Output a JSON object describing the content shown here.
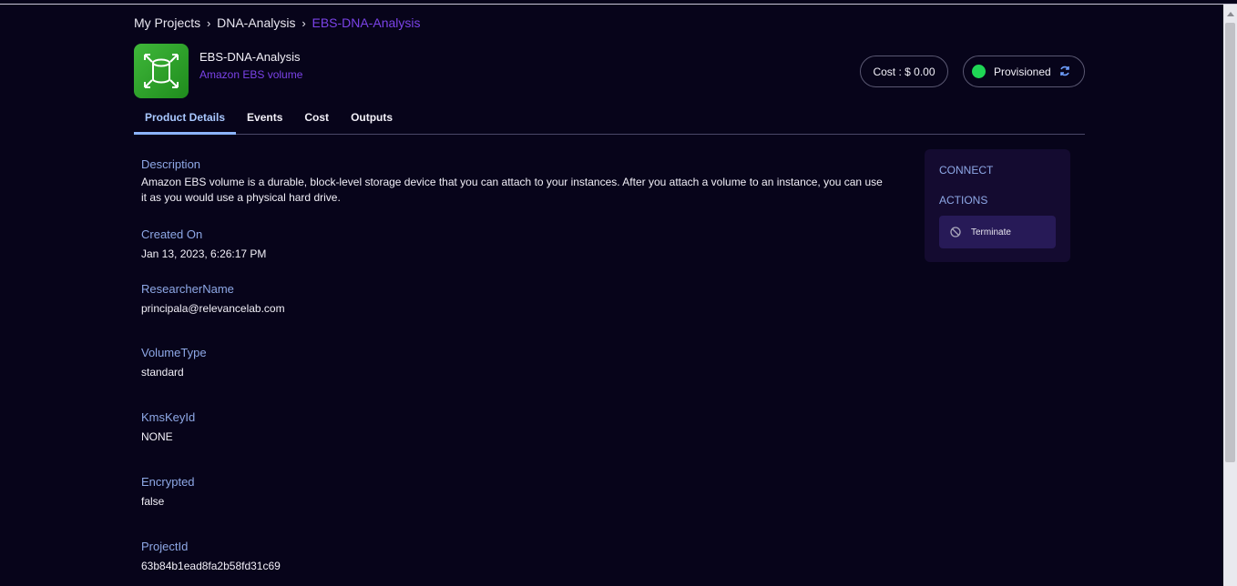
{
  "breadcrumb": {
    "items": [
      "My Projects",
      "DNA-Analysis",
      "EBS-DNA-Analysis"
    ]
  },
  "product": {
    "name": "EBS-DNA-Analysis",
    "type": "Amazon EBS volume",
    "icon": "ebs-volume-icon"
  },
  "cost": {
    "label": "Cost : $ 0.00"
  },
  "status": {
    "label": "Provisioned",
    "color": "#1fd655"
  },
  "tabs": [
    "Product Details",
    "Events",
    "Cost",
    "Outputs"
  ],
  "details": {
    "description": {
      "label": "Description",
      "value": "Amazon EBS volume is a durable, block-level storage device that you can attach to your instances. After you attach a volume to an instance, you can use it as you would use a physical hard drive."
    },
    "created_on": {
      "label": "Created On",
      "value": "Jan 13, 2023, 6:26:17 PM"
    },
    "researcher": {
      "label": "ResearcherName",
      "value": "principala@relevancelab.com"
    },
    "volume_type": {
      "label": "VolumeType",
      "value": "standard"
    },
    "kms_key": {
      "label": "KmsKeyId",
      "value": "NONE"
    },
    "encrypted": {
      "label": "Encrypted",
      "value": "false"
    },
    "project_id": {
      "label": "ProjectId",
      "value": "63b84b1ead8fa2b58fd31c69"
    }
  },
  "side": {
    "connect": "CONNECT",
    "actions": "ACTIONS",
    "terminate": "Terminate"
  },
  "colors": {
    "background": "#07041a",
    "accent": "#7b43e8",
    "label": "#8ea8e6",
    "active_tab": "#8cb4ff"
  }
}
